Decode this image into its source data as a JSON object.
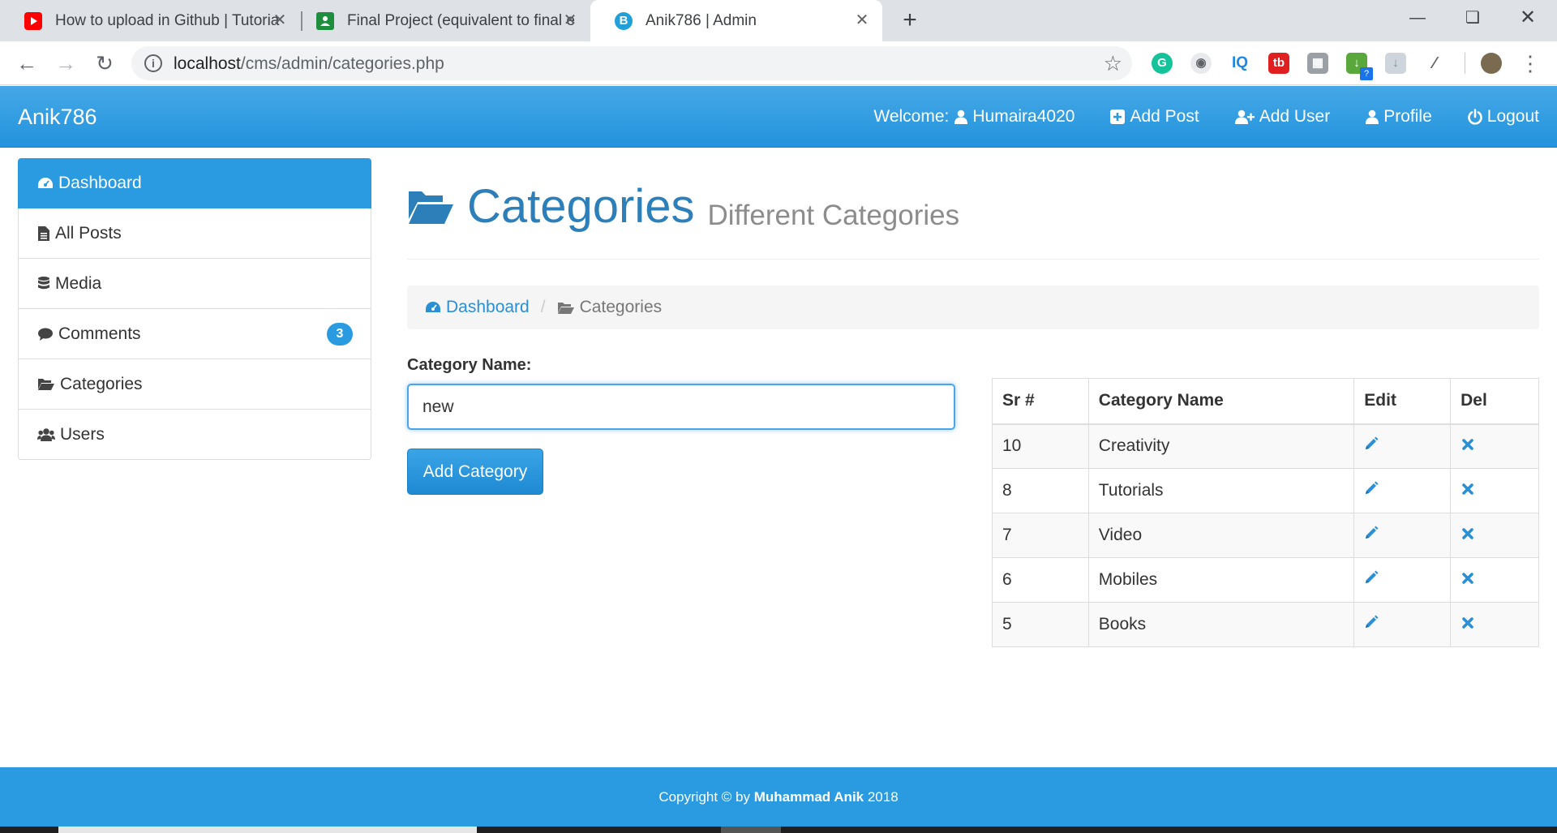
{
  "browser": {
    "tabs": [
      {
        "title": "How to upload in Github | Tutoria",
        "favicon": "youtube-icon"
      },
      {
        "title": "Final Project (equivalent to final e",
        "favicon": "classroom-icon"
      },
      {
        "title": "Anik786 | Admin",
        "favicon": "b-icon"
      }
    ],
    "url_host": "localhost",
    "url_path": "/cms/admin/categories.php",
    "extension_badge": "?"
  },
  "navbar": {
    "brand": "Anik786",
    "welcome_label": "Welcome:",
    "username": "Humaira4020",
    "add_post": "Add Post",
    "add_user": "Add User",
    "profile": "Profile",
    "logout": "Logout"
  },
  "sidebar": {
    "items": [
      {
        "label": "Dashboard",
        "icon": "dashboard-icon",
        "active": true
      },
      {
        "label": "All Posts",
        "icon": "file-icon"
      },
      {
        "label": "Media",
        "icon": "database-icon"
      },
      {
        "label": "Comments",
        "icon": "comment-icon",
        "badge": "3"
      },
      {
        "label": "Categories",
        "icon": "folder-open-icon"
      },
      {
        "label": "Users",
        "icon": "users-icon"
      }
    ]
  },
  "page": {
    "title": "Categories",
    "subtitle": "Different Categories"
  },
  "breadcrumb": {
    "home": "Dashboard",
    "sep": "/",
    "current": "Categories"
  },
  "form": {
    "label": "Category Name:",
    "value": "new",
    "submit": "Add Category"
  },
  "table": {
    "headers": [
      "Sr #",
      "Category Name",
      "Edit",
      "Del"
    ],
    "rows": [
      {
        "sr": "10",
        "name": "Creativity"
      },
      {
        "sr": "8",
        "name": "Tutorials"
      },
      {
        "sr": "7",
        "name": "Video"
      },
      {
        "sr": "6",
        "name": "Mobiles"
      },
      {
        "sr": "5",
        "name": "Books"
      }
    ]
  },
  "footer": {
    "prefix": "Copyright © by ",
    "author": "Muhammad Anik",
    "year": " 2018"
  },
  "colors": {
    "primary": "#2a9be0",
    "title": "#2c7fb8",
    "youtube": "#ff0000",
    "classroom": "#1e8e3e"
  }
}
